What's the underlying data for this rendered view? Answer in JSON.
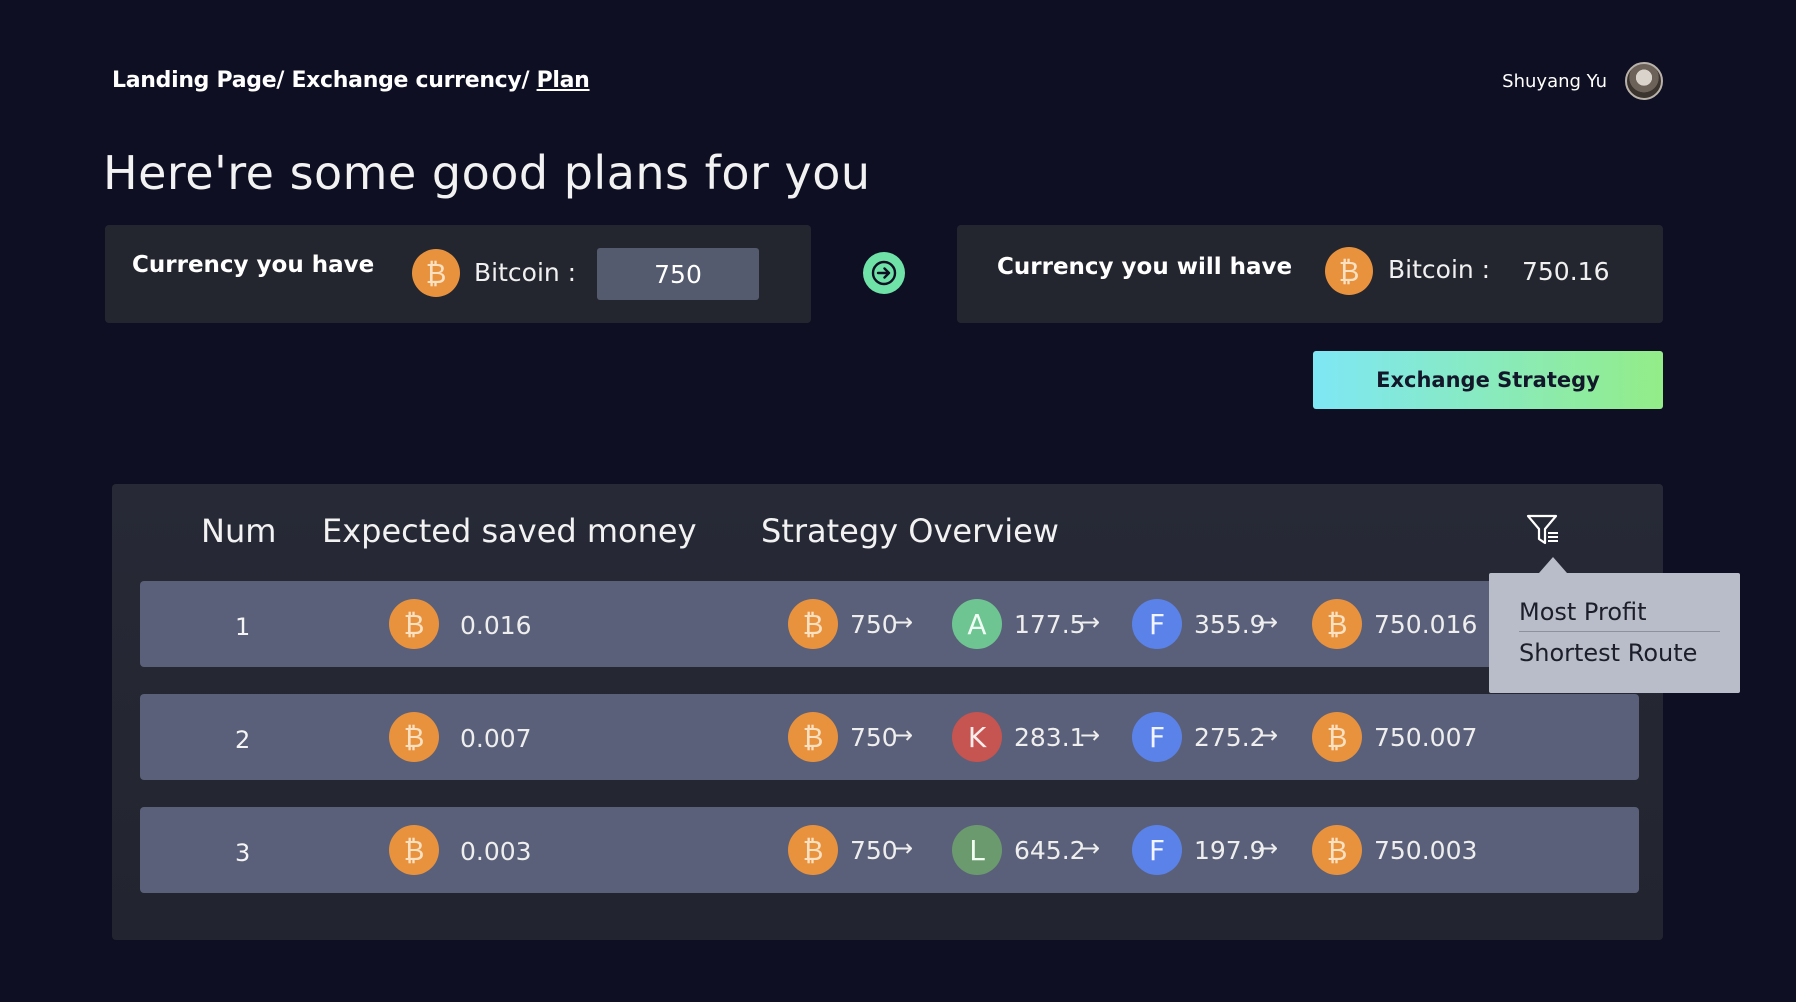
{
  "breadcrumb": {
    "items": [
      "Landing Page/",
      "Exchange currency/",
      "Plan"
    ]
  },
  "user": {
    "name": "Shuyang Yu"
  },
  "page_title": "Here're some good plans for you",
  "have": {
    "label": "Currency you have",
    "coin_letter": "₿",
    "currency": "Bitcoin :",
    "amount": "750"
  },
  "will_have": {
    "label": "Currency you will have",
    "coin_letter": "₿",
    "currency": "Bitcoin :",
    "amount": "750.16"
  },
  "strategy_button": "Exchange Strategy",
  "table": {
    "headers": {
      "num": "Num",
      "saved": "Expected saved money",
      "overview": "Strategy Overview"
    },
    "rows": [
      {
        "num": "1",
        "saved": "0.016",
        "steps": [
          {
            "coin": "₿",
            "type": "b",
            "value": "750"
          },
          {
            "coin": "A",
            "type": "a",
            "value": "177.5"
          },
          {
            "coin": "F",
            "type": "f",
            "value": "355.9"
          },
          {
            "coin": "₿",
            "type": "b",
            "value": "750.016"
          }
        ]
      },
      {
        "num": "2",
        "saved": "0.007",
        "steps": [
          {
            "coin": "₿",
            "type": "b",
            "value": "750"
          },
          {
            "coin": "K",
            "type": "k",
            "value": "283.1"
          },
          {
            "coin": "F",
            "type": "f",
            "value": "275.2"
          },
          {
            "coin": "₿",
            "type": "b",
            "value": "750.007"
          }
        ]
      },
      {
        "num": "3",
        "saved": "0.003",
        "steps": [
          {
            "coin": "₿",
            "type": "b",
            "value": "750"
          },
          {
            "coin": "L",
            "type": "l",
            "value": "645.2"
          },
          {
            "coin": "F",
            "type": "f",
            "value": "197.9"
          },
          {
            "coin": "₿",
            "type": "b",
            "value": "750.003"
          }
        ]
      }
    ],
    "arrow": "→"
  },
  "sort_menu": {
    "options": [
      "Most Profit",
      "Shortest Route"
    ]
  },
  "icons": {
    "filter": "filter-icon",
    "go": "arrow-right-icon",
    "bitcoin": "bitcoin-icon"
  },
  "colors": {
    "background": "#0e0f22",
    "bitcoin": "#e8923e",
    "go_button": "#6fe2a8",
    "gradient_start": "#7ee7f5",
    "gradient_end": "#93ed87"
  }
}
